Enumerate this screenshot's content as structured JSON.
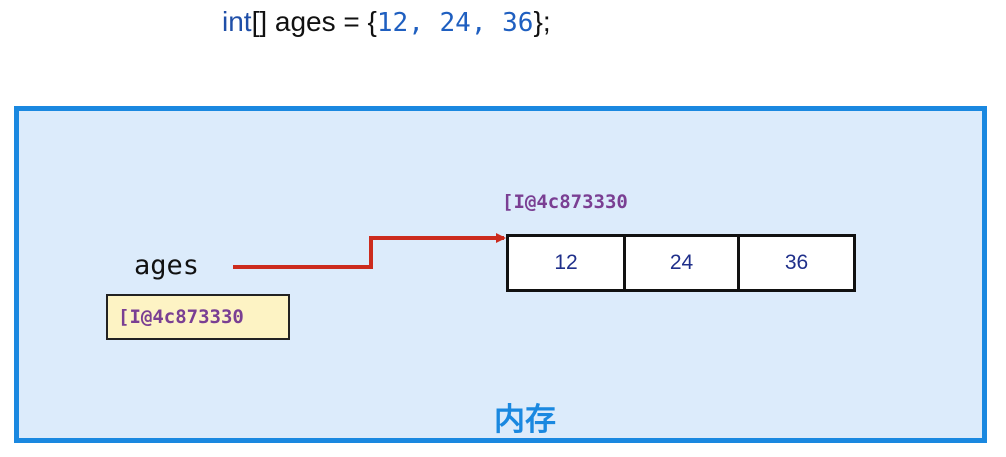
{
  "code": {
    "type_keyword": "int",
    "rest": "[] ages = {",
    "values": [
      "12",
      "24",
      "36"
    ],
    "separator": ", ",
    "closing": "};"
  },
  "memory": {
    "title": "内存",
    "variable_name": "ages",
    "variable_value": "[I@4c873330",
    "array_address": "[I@4c873330",
    "array_cells": [
      "12",
      "24",
      "36"
    ]
  },
  "colors": {
    "memory_border": "#1a88e0",
    "memory_fill": "#dcebfb",
    "pointer_arrow": "#cc2b1d",
    "address_text": "#7a3f93",
    "value_box_fill": "#fdf3c4"
  }
}
